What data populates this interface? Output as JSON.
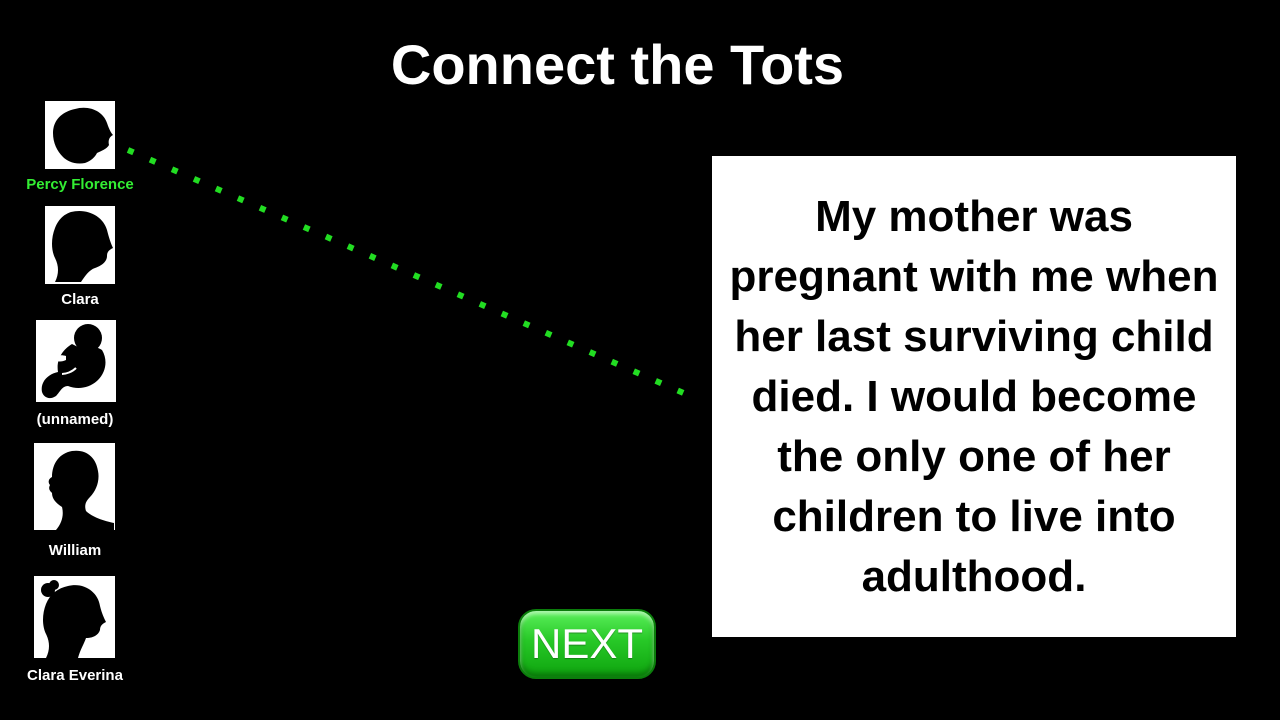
{
  "title": "Connect the Tots",
  "children": [
    {
      "name": "Percy Florence",
      "silhouette": "boy-profile-icon",
      "selected": true
    },
    {
      "name": "Clara",
      "silhouette": "child-profile-icon",
      "selected": false
    },
    {
      "name": "(unnamed)",
      "silhouette": "infant-icon",
      "selected": false
    },
    {
      "name": "William",
      "silhouette": "young-child-profile-icon",
      "selected": false
    },
    {
      "name": "Clara Everina",
      "silhouette": "girl-profile-icon",
      "selected": false
    }
  ],
  "clue": {
    "text": "My mother was pregnant with me when her last surviving child died. I would become the only one of her children to live into adulthood."
  },
  "next_button": {
    "label": "NEXT"
  },
  "colors": {
    "background": "#000000",
    "selected_label": "#33ee33",
    "connector_line": "#22dd22",
    "button_green": "#27c827"
  }
}
